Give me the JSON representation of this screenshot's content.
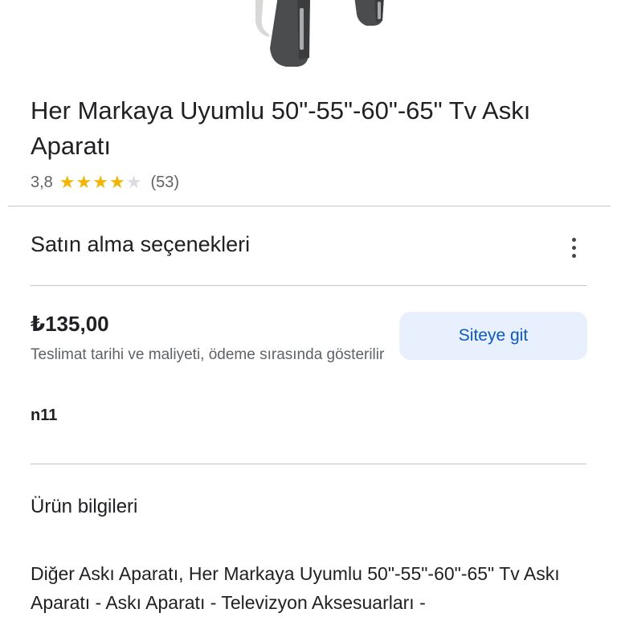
{
  "product": {
    "title": "Her Markaya Uyumlu 50\"-55\"-60\"-65\" Tv Askı Aparatı",
    "rating": 3.8,
    "rating_text": "3,8",
    "review_count": "(53)",
    "stars": [
      "on",
      "on",
      "on",
      "on",
      "off"
    ]
  },
  "purchase": {
    "section_title": "Satın alma seçenekleri",
    "more_icon": "more-vert-icon",
    "price": "₺135,00",
    "delivery_note": "Teslimat tarihi ve maliyeti, ödeme sırasında gösterilir",
    "seller": "n11",
    "site_button_label": "Siteye git"
  },
  "info": {
    "section_title": "Ürün bilgileri",
    "description": "Diğer Askı Aparatı, Her Markaya Uyumlu 50\"-55\"-60\"-65\" Tv Askı Aparatı - Askı Aparatı - Televizyon Aksesuarları -"
  },
  "colors": {
    "star": "#f4b400",
    "button_bg": "#e8f0fe",
    "button_text": "#0b57d0"
  }
}
